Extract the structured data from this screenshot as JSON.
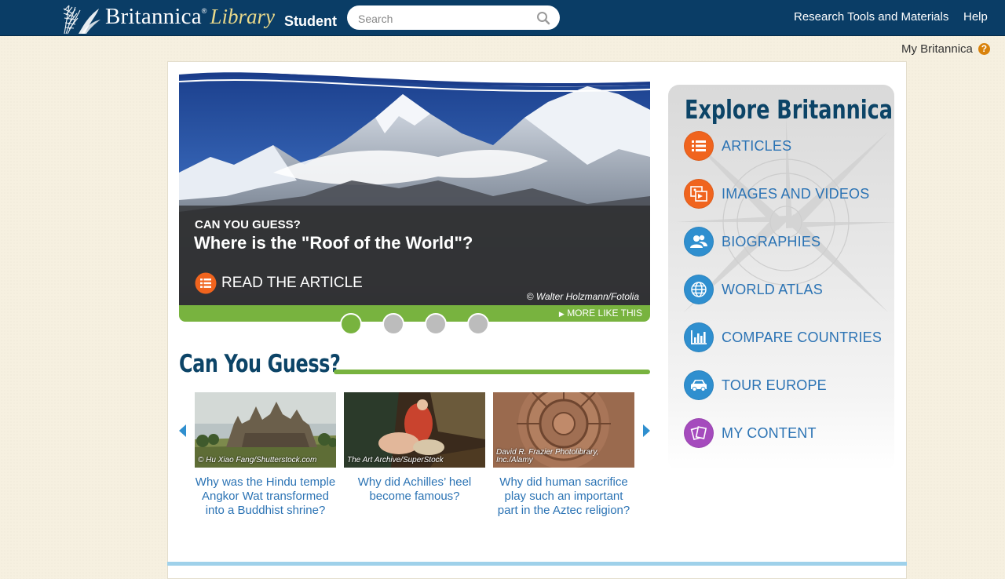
{
  "header": {
    "logo_name": "Britannica",
    "logo_reg": "®",
    "logo_library": "Library",
    "edition": "Student",
    "search_placeholder": "Search",
    "nav": {
      "research": "Research Tools and Materials",
      "help": "Help"
    }
  },
  "account": {
    "label": "My Britannica",
    "help_glyph": "?"
  },
  "hero": {
    "kicker": "CAN YOU GUESS?",
    "title": "Where is the \"Roof of the World\"?",
    "cta": "READ THE ARTICLE",
    "credit": "© Walter Holzmann/Fotolia",
    "more_like_this": "MORE LIKE THIS",
    "slides": 4,
    "active_slide": 1
  },
  "can_you_guess": {
    "heading": "Can You Guess?",
    "cards": [
      {
        "credit": "© Hu Xiao Fang/Shutterstock.com",
        "question": "Why was the Hindu temple Angkor Wat transformed into a Buddhist shrine?"
      },
      {
        "credit": "The Art Archive/SuperStock",
        "question": "Why did Achilles’ heel become famous?"
      },
      {
        "credit": "David R. Frazier Photolibrary, Inc./Alamy",
        "question": "Why did human sacrifice play such an important part in the Aztec religion?"
      }
    ]
  },
  "explore": {
    "title": "Explore Britannica",
    "items": [
      {
        "label": "ARTICLES",
        "icon": "list-icon",
        "color": "#f0641e"
      },
      {
        "label": "IMAGES AND VIDEOS",
        "icon": "media-icon",
        "color": "#f0641e"
      },
      {
        "label": "BIOGRAPHIES",
        "icon": "people-icon",
        "color": "#2f8fcf"
      },
      {
        "label": "WORLD ATLAS",
        "icon": "globe-icon",
        "color": "#2f8fcf"
      },
      {
        "label": "COMPARE COUNTRIES",
        "icon": "bar-chart-icon",
        "color": "#2f8fcf"
      },
      {
        "label": "TOUR EUROPE",
        "icon": "car-icon",
        "color": "#2f8fcf"
      },
      {
        "label": "MY CONTENT",
        "icon": "cards-icon",
        "color": "#a54bbd"
      }
    ]
  },
  "colors": {
    "header_bg": "#0a3d66",
    "accent_green": "#78b33f",
    "link_blue": "#2b73b4",
    "heading_navy": "#0c4467"
  }
}
